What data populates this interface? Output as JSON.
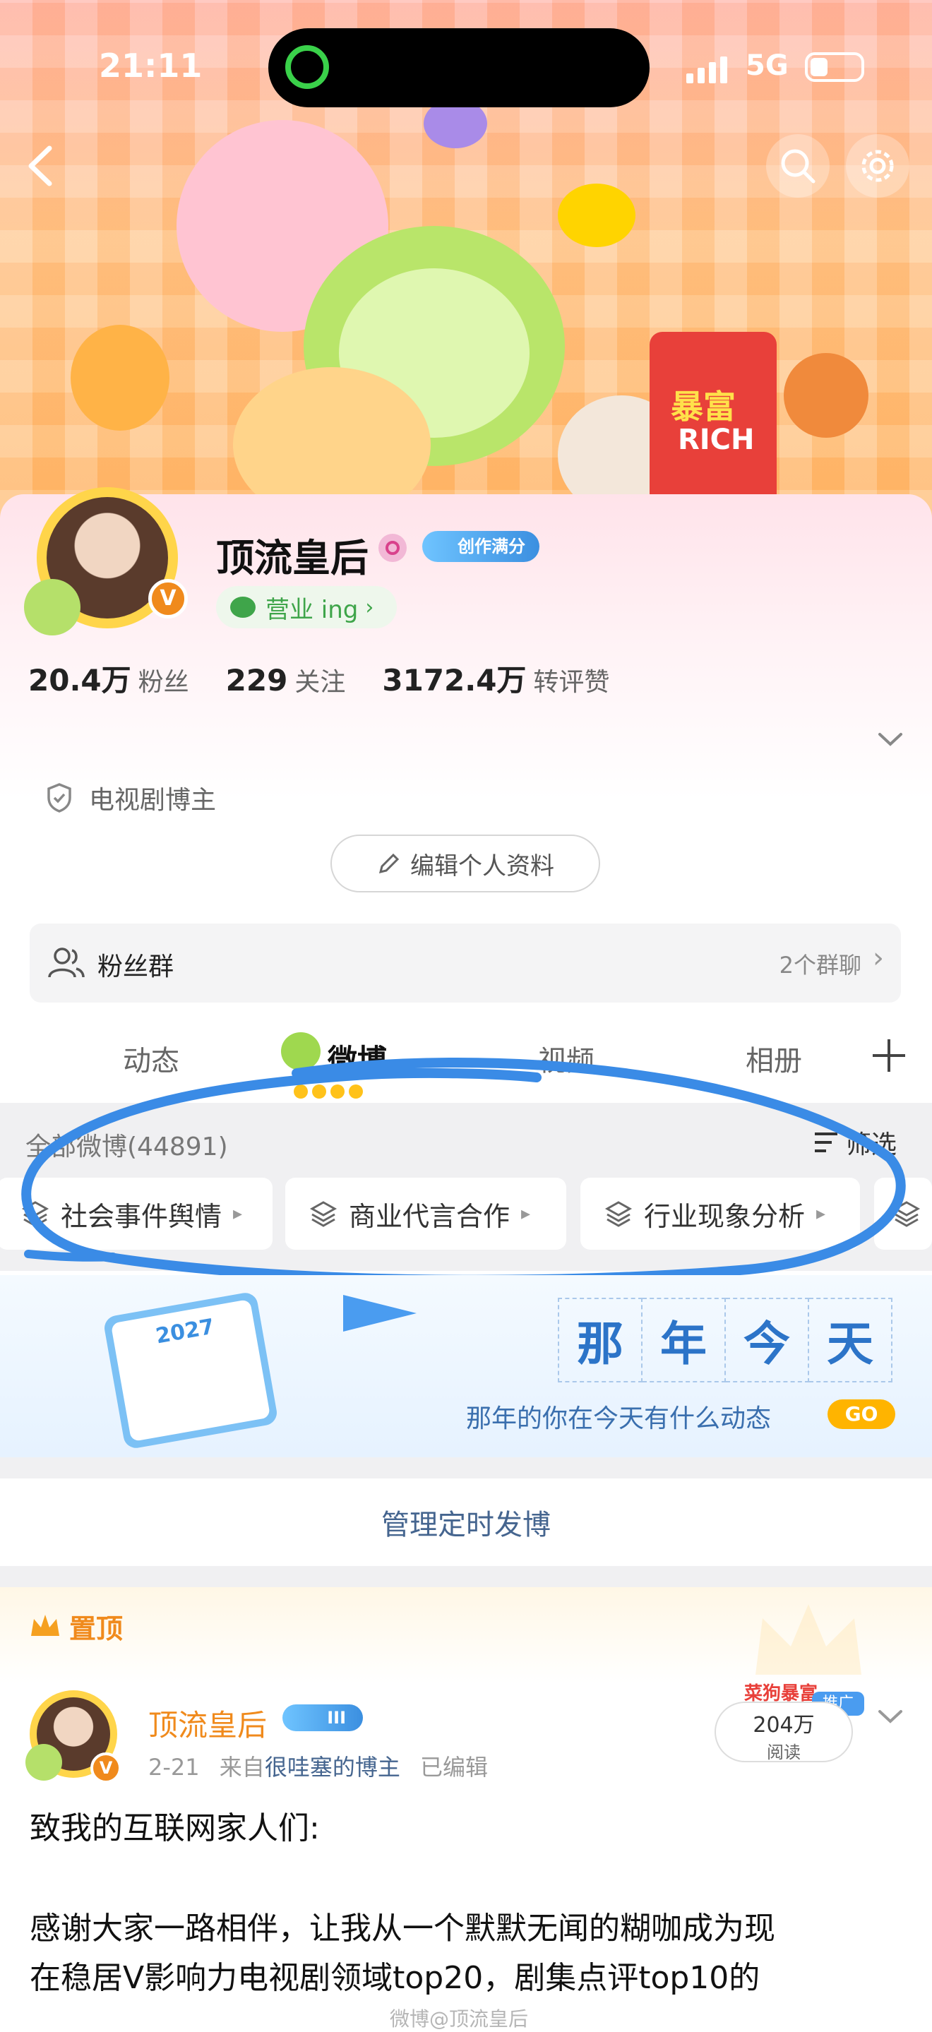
{
  "status": {
    "time": "21:11",
    "network": "5G"
  },
  "profile": {
    "name": "顶流皇后",
    "creator_badge": "创作满分",
    "status_pill": "营业 ing",
    "stats": [
      {
        "num": "20.4万",
        "label": "粉丝"
      },
      {
        "num": "229",
        "label": "关注"
      },
      {
        "num": "3172.4万",
        "label": "转评赞"
      }
    ],
    "category": "电视剧博主",
    "edit_label": "编辑个人资料"
  },
  "fan_group": {
    "label": "粉丝群",
    "count": "2个群聊"
  },
  "tabs": [
    {
      "label": "动态"
    },
    {
      "label": "微博"
    },
    {
      "label": "视频"
    },
    {
      "label": "相册"
    }
  ],
  "feed": {
    "all_label": "全部微博(44891)",
    "filter_label": "筛选",
    "chips": [
      {
        "label": "社会事件舆情"
      },
      {
        "label": "商业代言合作"
      },
      {
        "label": "行业现象分析"
      }
    ]
  },
  "memory_banner": {
    "year": "2027",
    "title_chars": [
      "那",
      "年",
      "今",
      "天"
    ],
    "subtitle": "那年的你在今天有什么动态",
    "go_label": "GO"
  },
  "manage_scheduled": "管理定时发博",
  "pinned": {
    "label": "置顶",
    "author": "顶流皇后",
    "level": "III",
    "date": "2-21",
    "source_prefix": "来自",
    "source": "很哇塞的博主",
    "edited": "已编辑",
    "reads_num": "204万",
    "reads_label": "阅读",
    "promo_tag": "推广",
    "body_line1": "致我的互联网家人们:",
    "body_line2": "感谢大家一路相伴，让我从一个默默无闻的糊咖成为现",
    "body_line3": "在稳居V影响力电视剧领域top20，剧集点评top10的",
    "watermark": "微博@顶流皇后"
  },
  "colors": {
    "accent_blue": "#3b8fe0",
    "brand_orange": "#f08a1c",
    "pill_green": "#3fa54a",
    "annotation_blue": "#3a8be6"
  },
  "icons": [
    "back-icon",
    "search-icon",
    "gear-icon",
    "shield-icon",
    "pencil-icon",
    "group-icon",
    "plus-icon",
    "filter-icon",
    "layers-icon",
    "crown-icon",
    "chevron-down-icon"
  ]
}
